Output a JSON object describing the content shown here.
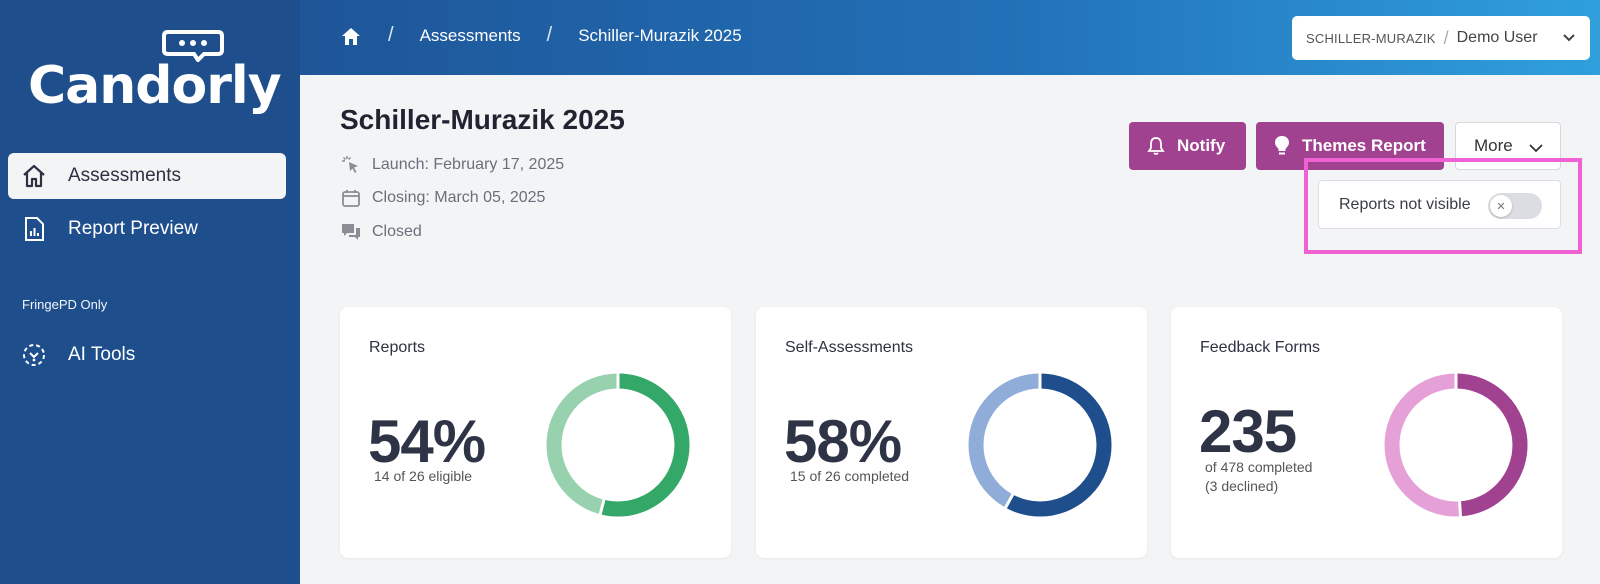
{
  "app": {
    "logo_text": "Candorly"
  },
  "sidebar": {
    "items": [
      {
        "label": "Assessments",
        "icon": "home-icon",
        "active": true
      },
      {
        "label": "Report Preview",
        "icon": "report-icon",
        "active": false
      }
    ],
    "section_label": "FringePD Only",
    "section_items": [
      {
        "label": "AI Tools",
        "icon": "ai-tools-icon"
      }
    ]
  },
  "header": {
    "breadcrumb": [
      "Assessments",
      "Schiller-Murazik 2025"
    ],
    "org": "SCHILLER-MURAZIK",
    "user": "Demo User"
  },
  "page": {
    "title": "Schiller-Murazik 2025",
    "launch": "Launch: February 17, 2025",
    "closing": "Closing: March 05, 2025",
    "status": "Closed"
  },
  "actions": {
    "notify": "Notify",
    "themes_report": "Themes Report",
    "more": "More",
    "reports_visibility_label": "Reports not visible",
    "reports_visible": false
  },
  "cards": [
    {
      "title": "Reports",
      "value": "54%",
      "sub1": "14 of 26 eligible",
      "sub2": "",
      "fraction": 0.54,
      "color_main": "#34a868",
      "color_rest": "#98d1ae"
    },
    {
      "title": "Self-Assessments",
      "value": "58%",
      "sub1": "15 of 26 completed",
      "sub2": "",
      "fraction": 0.58,
      "color_main": "#1f4e8c",
      "color_rest": "#8fadd8"
    },
    {
      "title": "Feedback Forms",
      "value": "235",
      "sub1": "of 478 completed",
      "sub2": "(3 declined)",
      "fraction": 0.49,
      "color_main": "#a0428f",
      "color_rest": "#e5a0d8"
    }
  ],
  "colors": {
    "sidebar": "#1f4e8c",
    "accent": "#a0428f",
    "highlight": "#f062d4"
  }
}
